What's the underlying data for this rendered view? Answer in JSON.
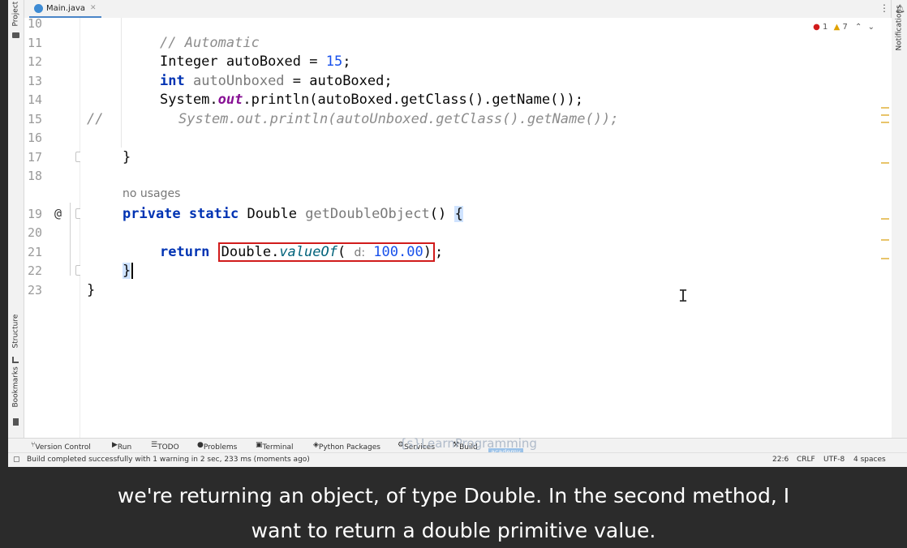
{
  "window": {
    "file_tab": "Main.java"
  },
  "tool_windows": {
    "left_top": "Project",
    "left_mid": "Structure",
    "left_bottom": "Bookmarks",
    "right": "Notifications"
  },
  "inspections": {
    "errors": "1",
    "warnings": "7"
  },
  "editor": {
    "lines": [
      {
        "n": "10"
      },
      {
        "n": "11"
      },
      {
        "n": "12"
      },
      {
        "n": "13"
      },
      {
        "n": "14"
      },
      {
        "n": "15"
      },
      {
        "n": "16"
      },
      {
        "n": "17"
      },
      {
        "n": "18"
      },
      {
        "n": "19"
      },
      {
        "n": "20"
      },
      {
        "n": "21"
      },
      {
        "n": "22"
      },
      {
        "n": "23"
      }
    ],
    "code": {
      "l11": "// Automatic",
      "l12_type": "Integer ",
      "l12_rest": "autoBoxed = ",
      "l12_num": "15",
      "l12_end": ";",
      "l13_kw": "int",
      "l13_var": " autoUnboxed",
      "l13_rest": " = autoBoxed;",
      "l14_a": "System.",
      "l14_out": "out",
      "l14_b": ".println(autoBoxed.getClass().getName());",
      "l15_prefix": "//",
      "l15_code": "System.out.println(autoUnboxed.getClass().getName());",
      "l17": "}",
      "usages": "no usages",
      "l19_mod": "private static ",
      "l19_type": "Double ",
      "l19_name": "getDoubleObject",
      "l19_paren": "() ",
      "l19_brace": "{",
      "l19_annot": "@",
      "l21_kw": "return ",
      "l21_class": "Double.",
      "l21_method": "valueOf",
      "l21_open": "( ",
      "l21_hint": "d:",
      "l21_num": " 100.00",
      "l21_close": ")",
      "l21_end": ";",
      "l22": "}",
      "l23": "}"
    }
  },
  "bottom_tools": {
    "version_control": "Version Control",
    "run": "Run",
    "todo": "TODO",
    "problems": "Problems",
    "terminal": "Terminal",
    "python_packages": "Python Packages",
    "services": "Services",
    "build": "Build"
  },
  "status": {
    "message": "Build completed successfully with 1 warning in 2 sec, 233 ms (moments ago)",
    "position": "22:6",
    "line_sep": "CRLF",
    "encoding": "UTF-8",
    "indent": "4 spaces"
  },
  "watermark": {
    "text": "{s}LearnProgramming",
    "sub": "academy"
  },
  "caption": {
    "line1": "we're returning an object, of type Double. In the second method, I",
    "line2": "want to return a double primitive value."
  },
  "colors": {
    "keyword": "#0033b3",
    "comment": "#8c8c8c",
    "number": "#1750eb",
    "highlight_box": "#d11b1b",
    "error": "#d11b1b",
    "warning": "#e0a100"
  }
}
